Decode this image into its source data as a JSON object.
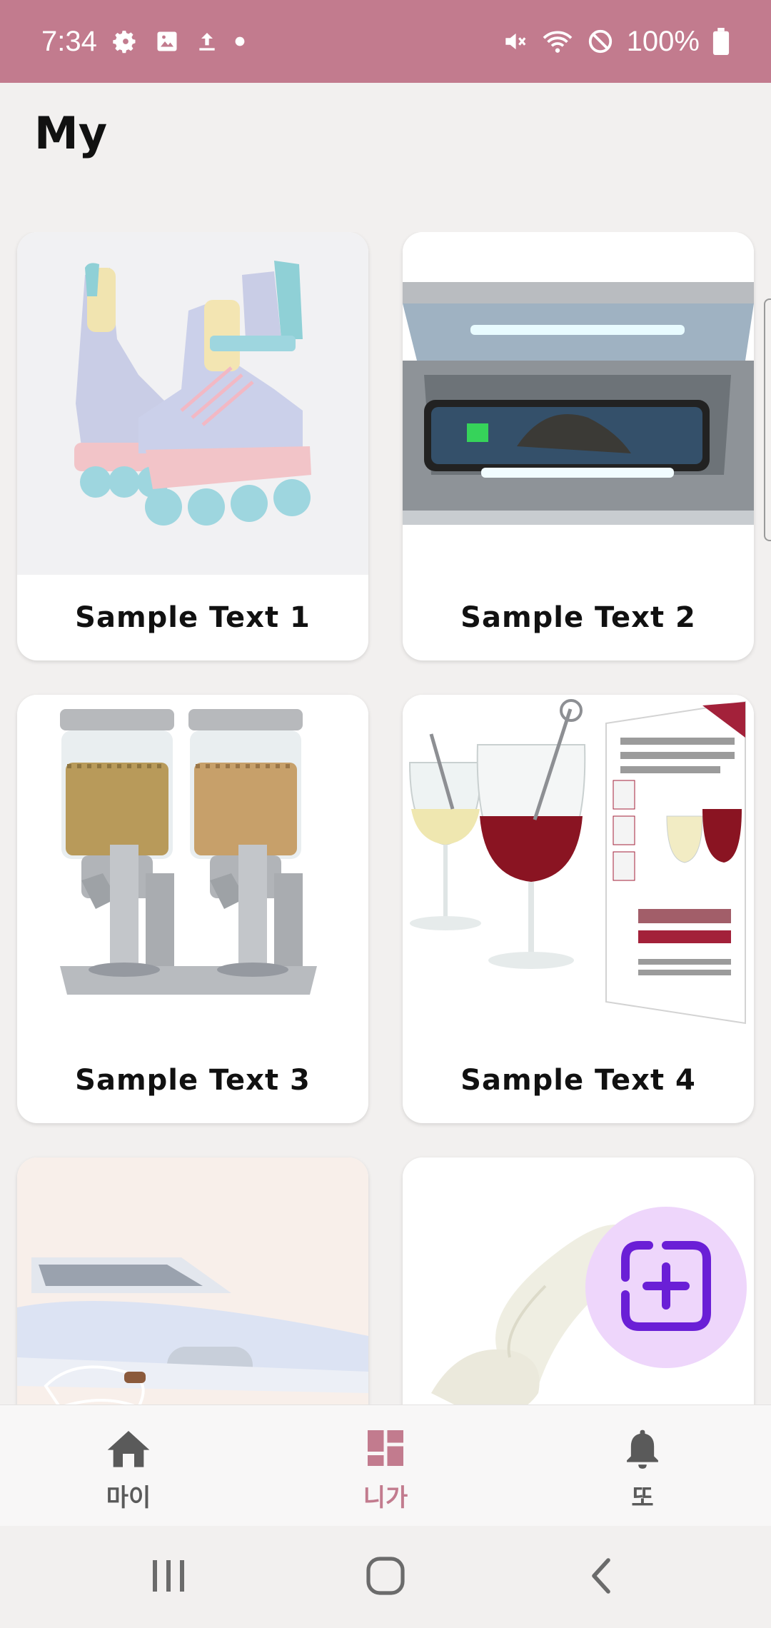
{
  "status_bar": {
    "time": "7:34",
    "battery": "100%",
    "icons": [
      "gear-icon",
      "image-icon",
      "upload-icon",
      "dot-icon",
      "mute-icon",
      "wifi-icon",
      "do-not-disturb-icon",
      "battery-icon"
    ]
  },
  "page": {
    "title": "My"
  },
  "cards": [
    {
      "label": "Sample Text 1",
      "image": "inline-skates-image"
    },
    {
      "label": "Sample Text 2",
      "image": "uv-phone-sanitizer-image"
    },
    {
      "label": "Sample Text 3",
      "image": "cereal-dispenser-image"
    },
    {
      "label": "Sample Text 4",
      "image": "wine-wand-image"
    },
    {
      "label": "",
      "image": "steam-iron-image"
    },
    {
      "label": "",
      "image": "body-pillow-image"
    }
  ],
  "fab": {
    "icon": "add-square-icon",
    "color": "#6a1fd6",
    "background": "#eed6fb"
  },
  "bottom_nav": {
    "items": [
      {
        "label": "마이",
        "icon": "home-icon",
        "active": false
      },
      {
        "label": "니가",
        "icon": "dashboard-icon",
        "active": true
      },
      {
        "label": "또",
        "icon": "bell-icon",
        "active": false
      }
    ],
    "active_color": "#c27b8e",
    "inactive_color": "#5a5a5a"
  },
  "colors": {
    "accent": "#c27b8e",
    "background": "#f2f0ef"
  }
}
